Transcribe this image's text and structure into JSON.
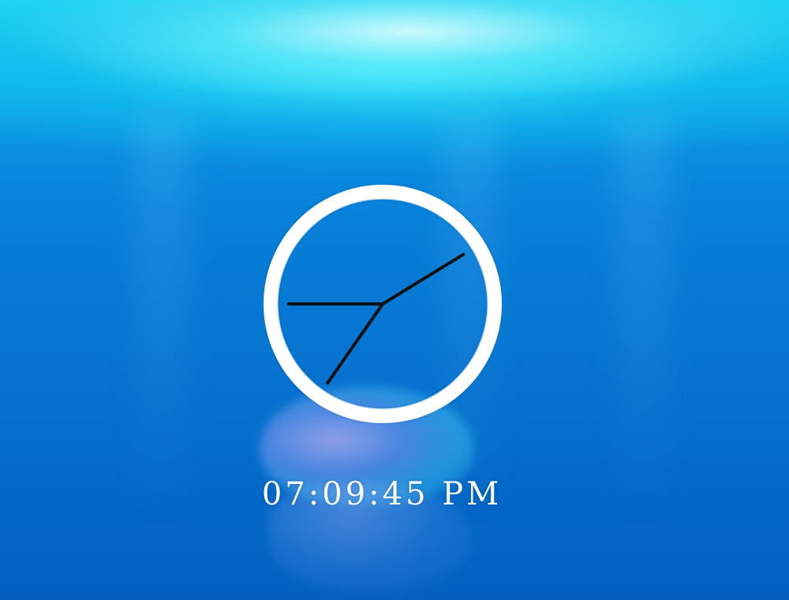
{
  "clock": {
    "digital_time": "07:09:45 PM",
    "hour": 7,
    "minute": 9,
    "second": 45,
    "face_color": "#ffffff",
    "hand_color": "#111111"
  },
  "background": {
    "top_color": "#1fd6f2",
    "mid_color": "#087fd8",
    "bottom_color": "#045fbf",
    "scene": "underwater-jellyfish"
  }
}
